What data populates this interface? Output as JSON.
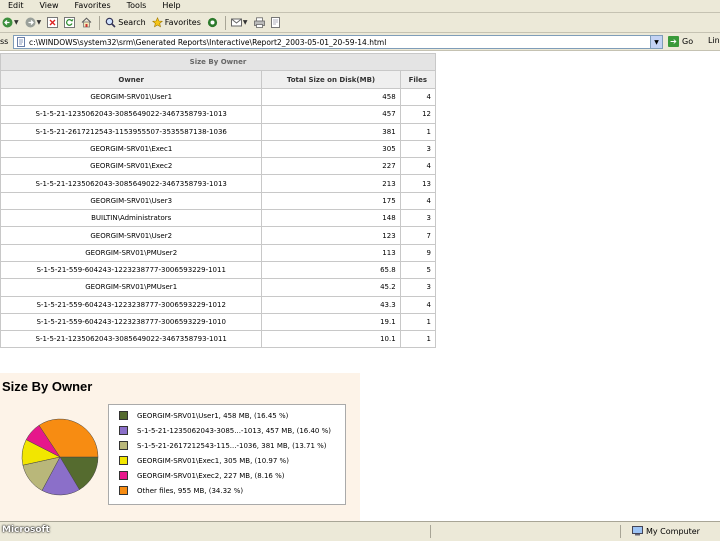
{
  "menu": [
    "Edit",
    "View",
    "Favorites",
    "Tools",
    "Help"
  ],
  "toolbar": {
    "search_label": "Search",
    "favorites_label": "Favorites"
  },
  "address": {
    "label": "ss",
    "url": "c:\\WINDOWS\\system32\\srm\\Generated Reports\\Interactive\\Report2_2003-05-01_20-59-14.html",
    "go_label": "Go",
    "links_label": "Lin"
  },
  "table": {
    "caption": "Size By Owner",
    "headers": [
      "Owner",
      "Total Size on Disk(MB)",
      "Files"
    ],
    "rows": [
      {
        "owner": "GEORGIM-SRV01\\User1",
        "size": "458",
        "files": "4"
      },
      {
        "owner": "S-1-5-21-1235062043-3085649022-3467358793-1013",
        "size": "457",
        "files": "12"
      },
      {
        "owner": "S-1-5-21-2617212543-1153955507-3535587138-1036",
        "size": "381",
        "files": "1"
      },
      {
        "owner": "GEORGIM-SRV01\\Exec1",
        "size": "305",
        "files": "3"
      },
      {
        "owner": "GEORGIM-SRV01\\Exec2",
        "size": "227",
        "files": "4"
      },
      {
        "owner": "S-1-5-21-1235062043-3085649022-3467358793-1013",
        "size": "213",
        "files": "13"
      },
      {
        "owner": "GEORGIM-SRV01\\User3",
        "size": "175",
        "files": "4"
      },
      {
        "owner": "BUILTIN\\Administrators",
        "size": "148",
        "files": "3"
      },
      {
        "owner": "GEORGIM-SRV01\\User2",
        "size": "123",
        "files": "7"
      },
      {
        "owner": "GEORGIM-SRV01\\PMUser2",
        "size": "113",
        "files": "9"
      },
      {
        "owner": "S-1-5-21-559-604243-1223238777-3006593229-1011",
        "size": "65.8",
        "files": "5"
      },
      {
        "owner": "GEORGIM-SRV01\\PMUser1",
        "size": "45.2",
        "files": "3"
      },
      {
        "owner": "S-1-5-21-559-604243-1223238777-3006593229-1012",
        "size": "43.3",
        "files": "4"
      },
      {
        "owner": "S-1-5-21-559-604243-1223238777-3006593229-1010",
        "size": "19.1",
        "files": "1"
      },
      {
        "owner": "S-1-5-21-1235062043-3085649022-3467358793-1011",
        "size": "10.1",
        "files": "1"
      }
    ]
  },
  "chart": {
    "title": "Size By Owner"
  },
  "chart_data": {
    "type": "pie",
    "title": "Size By Owner",
    "legend_position": "right",
    "series": [
      {
        "name": "GEORGIM-SRV01\\User1",
        "label": "GEORGIM-SRV01\\User1, 458 MB, (16.45 %)",
        "value": 16.45,
        "color": "#556b2f"
      },
      {
        "name": "S-1-5-21-1235062043-3085...-1013",
        "label": "S-1-5-21-1235062043-3085...-1013, 457 MB, (16.40 %)",
        "value": 16.4,
        "color": "#8b6fc9"
      },
      {
        "name": "S-1-5-21-2617212543-115...-1036",
        "label": "S-1-5-21-2617212543-115...-1036, 381 MB, (13.71 %)",
        "value": 13.71,
        "color": "#b9b77a"
      },
      {
        "name": "GEORGIM-SRV01\\Exec1",
        "label": "GEORGIM-SRV01\\Exec1, 305 MB, (10.97 %)",
        "value": 10.97,
        "color": "#f2e600"
      },
      {
        "name": "GEORGIM-SRV01\\Exec2",
        "label": "GEORGIM-SRV01\\Exec2, 227 MB, (8.16 %)",
        "value": 8.16,
        "color": "#e6178b"
      },
      {
        "name": "Other files",
        "label": "Other files, 955 MB, (34.32 %)",
        "value": 34.32,
        "color": "#f78c12"
      }
    ]
  },
  "status": {
    "left_text": "Microsoft",
    "zone_label": "My Computer"
  }
}
